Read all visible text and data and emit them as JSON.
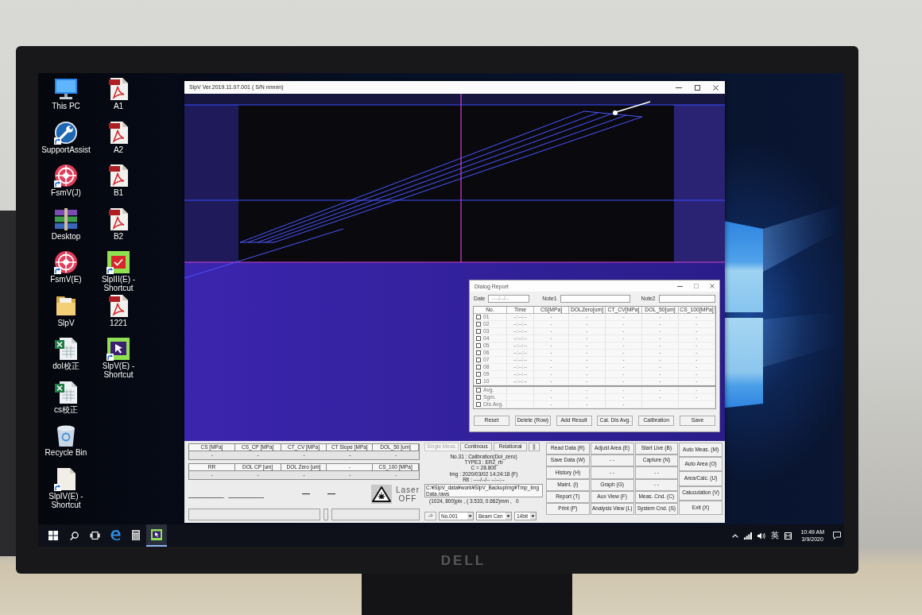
{
  "monitor": {
    "logo": "DELL"
  },
  "desktop_icon_columns": [
    {
      "icons": [
        {
          "label": "This PC",
          "kind": "computer",
          "shortcut": false
        },
        {
          "label": "SupportAssist",
          "kind": "tool",
          "shortcut": true
        },
        {
          "label": "FsmV(J)",
          "kind": "target",
          "shortcut": true
        },
        {
          "label": "Desktop",
          "kind": "archive",
          "shortcut": false
        },
        {
          "label": "FsmV(E)",
          "kind": "target",
          "shortcut": true
        },
        {
          "label": "SlpV",
          "kind": "folder",
          "shortcut": false
        },
        {
          "label": "dol校正",
          "kind": "spreadsheet",
          "shortcut": false
        },
        {
          "label": "cs校正",
          "kind": "spreadsheet",
          "shortcut": false
        },
        {
          "label": "Recycle Bin",
          "kind": "recycle",
          "shortcut": false
        },
        {
          "label": "SlpIV(E) - Shortcut",
          "kind": "blank",
          "shortcut": true
        }
      ]
    },
    {
      "icons": [
        {
          "label": "A1",
          "kind": "pdf",
          "shortcut": false
        },
        {
          "label": "A2",
          "kind": "pdf",
          "shortcut": false
        },
        {
          "label": "B1",
          "kind": "pdf",
          "shortcut": false
        },
        {
          "label": "B2",
          "kind": "pdf",
          "shortcut": false
        },
        {
          "label": "SlpIII(E) - Shortcut",
          "kind": "check_app",
          "shortcut": true
        },
        {
          "label": "1221",
          "kind": "pdf",
          "shortcut": false
        },
        {
          "label": "SlpV(E) - Shortcut",
          "kind": "pointer_app",
          "shortcut": true
        }
      ]
    }
  ],
  "app_window": {
    "title": "SlpV Ver.2019.11.07.001 ( S/N nnnnn)",
    "result_tables": [
      {
        "columns": [
          "CS [MPa]",
          "CS_CP [MPa]",
          "CT_CV [MPa]",
          "CT Slope [MPa]",
          "DOL_50 [um]"
        ],
        "values": [
          "-",
          "-",
          "-",
          "-",
          "-"
        ]
      },
      {
        "columns": [
          "RR",
          "DOL CP [um]",
          "DOL Zero [um]",
          "-",
          "CS_100 [MPa]"
        ],
        "values": [
          "-",
          "-",
          "-",
          "-",
          "-"
        ]
      }
    ],
    "readouts": [
      "________",
      "________",
      "—",
      "—"
    ],
    "laser": {
      "label": "Laser",
      "state": "OFF"
    },
    "mode_buttons": [
      {
        "label": "Single Meas.",
        "disabled": true
      },
      {
        "label": "Continous",
        "disabled": false
      },
      {
        "label": "Relational",
        "disabled": false
      },
      {
        "label": "||",
        "disabled": false
      }
    ],
    "info_lines": [
      "No.31 : Calibration(Dol_zero)",
      "TYPE3 : ER2_rb",
      "C = 28.800",
      "Img : 2020/03/02 14:24:18 (F)",
      "Rlt : ----/--/-- --:--:--"
    ],
    "file_path": "C:¥SlpV_data¥work¥SlpV_BackupImg¥Tmp_ImgData.raws",
    "image_info": "(1024, 800)pix , ( 3.533, 0.662)mm ,   0",
    "go_button": "->",
    "selectors": [
      "No.001",
      "Beam Cen",
      "14bit"
    ],
    "command_columns": [
      [
        "Read Data (R)",
        "Save Data (W)",
        "History (H)",
        "Maint. (I)",
        "Report (T)",
        "Print (P)"
      ],
      [
        "Adjust Area (E)",
        "- -",
        "- -",
        "Graph (G)",
        "Aux View (F)",
        "Analysis View (L)"
      ],
      [
        "Start Live (B)",
        "Capture (N)",
        "- -",
        "- -",
        "Meas. Cnd. (C)",
        "System Cnd. (S)"
      ],
      [
        "Auto Meas. (M)",
        "Auto Area (O)",
        "Area/Calc. (U)",
        "Caluculation (V)",
        "Exit (X)"
      ]
    ]
  },
  "dialog_report": {
    "title": "Dialog Report",
    "date_label": "Date",
    "date_value": "----/--/--",
    "note_labels": [
      "Note1",
      "Note2"
    ],
    "columns": [
      "No.",
      "Time",
      "CS[MPa]",
      "DOLZero[um]",
      "CT_CV[MPa]",
      "DOL_50[um]",
      "CS_100[MPa]"
    ],
    "rows": [
      {
        "no": "01",
        "checked": false,
        "time": "--:--:--",
        "values": [
          "-",
          "-",
          "-",
          "-",
          "-"
        ]
      },
      {
        "no": "02",
        "checked": false,
        "time": "--:--:--",
        "values": [
          "-",
          "-",
          "-",
          "-",
          "-"
        ]
      },
      {
        "no": "03",
        "checked": false,
        "time": "--:--:--",
        "values": [
          "-",
          "-",
          "-",
          "-",
          "-"
        ]
      },
      {
        "no": "04",
        "checked": false,
        "time": "--:--:--",
        "values": [
          "-",
          "-",
          "-",
          "-",
          "-"
        ]
      },
      {
        "no": "05",
        "checked": false,
        "time": "--:--:--",
        "values": [
          "-",
          "-",
          "-",
          "-",
          "-"
        ]
      },
      {
        "no": "06",
        "checked": false,
        "time": "--:--:--",
        "values": [
          "-",
          "-",
          "-",
          "-",
          "-"
        ]
      },
      {
        "no": "07",
        "checked": false,
        "time": "--:--:--",
        "values": [
          "-",
          "-",
          "-",
          "-",
          "-"
        ]
      },
      {
        "no": "08",
        "checked": false,
        "time": "--:--:--",
        "values": [
          "-",
          "-",
          "-",
          "-",
          "-"
        ]
      },
      {
        "no": "09",
        "checked": false,
        "time": "--:--:--",
        "values": [
          "-",
          "-",
          "-",
          "-",
          "-"
        ]
      },
      {
        "no": "10",
        "checked": false,
        "time": "--:--:--",
        "values": [
          "-",
          "-",
          "-",
          "-",
          "-"
        ]
      }
    ],
    "summary_rows": [
      {
        "label": "Avg.",
        "checked": false,
        "values": [
          "-",
          "-",
          "-",
          "-",
          "-"
        ]
      },
      {
        "label": "Sgm.",
        "checked": false,
        "values": [
          "-",
          "-",
          "-",
          "-",
          "-"
        ]
      },
      {
        "label": "Dis.Avg.",
        "checked": false,
        "values": [
          "-",
          "-",
          "-"
        ]
      }
    ],
    "buttons": [
      "Reset",
      "Delete (Row)",
      "Add Result",
      "Cal. Dis Avg.",
      "Calibration",
      "Save"
    ]
  },
  "taskbar": {
    "pinned": [
      {
        "kind": "browser",
        "running": false
      },
      {
        "kind": "calculator",
        "running": false
      },
      {
        "kind": "app",
        "running": true
      }
    ],
    "tray_texts": [
      "英"
    ],
    "time": "10:49 AM",
    "date": "3/9/2020"
  }
}
